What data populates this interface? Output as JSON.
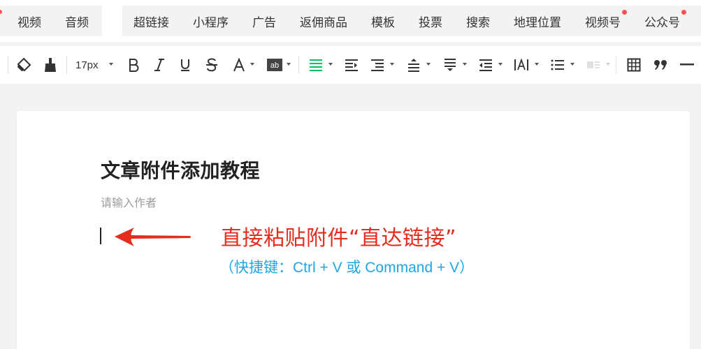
{
  "insert_bar": {
    "group1": [
      "视频",
      "音频"
    ],
    "group2": [
      {
        "label": "超链接",
        "dot": false
      },
      {
        "label": "小程序",
        "dot": false
      },
      {
        "label": "广告",
        "dot": false
      },
      {
        "label": "返佣商品",
        "dot": false
      },
      {
        "label": "模板",
        "dot": false
      },
      {
        "label": "投票",
        "dot": false
      },
      {
        "label": "搜索",
        "dot": false
      },
      {
        "label": "地理位置",
        "dot": false
      },
      {
        "label": "视频号",
        "dot": true
      },
      {
        "label": "公众号",
        "dot": true
      }
    ]
  },
  "toolbar": {
    "font_size": "17px",
    "accent_color": "#07c160",
    "icons": [
      "format-painter-icon",
      "clear-format-icon",
      "bold-icon",
      "italic-icon",
      "underline-icon",
      "strikethrough-icon",
      "font-color-icon",
      "background-color-icon",
      "align-icon",
      "indent-icon",
      "line-height-icon",
      "paragraph-spacing-icon",
      "list-icon",
      "table-icon",
      "quote-icon",
      "divider-icon"
    ]
  },
  "editor": {
    "title": "文章附件添加教程",
    "author_placeholder": "请输入作者",
    "annotation_main": "直接粘贴附件“直达链接”",
    "annotation_sub": "（快捷键：Ctrl + V 或 Command + V）",
    "annotation_color": "#e52d1d",
    "hint_color": "#1fa6e8"
  }
}
